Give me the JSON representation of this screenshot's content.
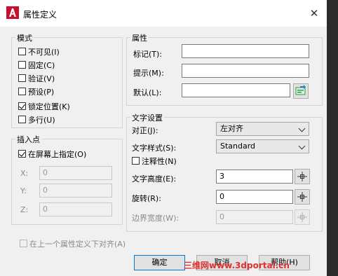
{
  "window": {
    "title": "属性定义",
    "close_glyph": "✕"
  },
  "mode": {
    "label": "模式",
    "options": [
      {
        "label": "不可见(I)",
        "checked": false
      },
      {
        "label": "固定(C)",
        "checked": false
      },
      {
        "label": "验证(V)",
        "checked": false
      },
      {
        "label": "预设(P)",
        "checked": false
      },
      {
        "label": "锁定位置(K)",
        "checked": true
      },
      {
        "label": "多行(U)",
        "checked": false
      }
    ]
  },
  "insertion": {
    "label": "插入点",
    "specify_on_screen": {
      "label": "在屏幕上指定(O)",
      "checked": true
    },
    "x": {
      "label": "X:",
      "value": "0"
    },
    "y": {
      "label": "Y:",
      "value": "0"
    },
    "z": {
      "label": "Z:",
      "value": "0"
    }
  },
  "attribute": {
    "label": "属性",
    "tag": {
      "label": "标记(T):",
      "value": ""
    },
    "prompt": {
      "label": "提示(M):",
      "value": ""
    },
    "default": {
      "label": "默认(L):",
      "value": ""
    }
  },
  "text_settings": {
    "label": "文字设置",
    "justification": {
      "label": "对正(J):",
      "value": "左对齐"
    },
    "text_style": {
      "label": "文字样式(S):",
      "value": "Standard"
    },
    "annotative": {
      "label": "注释性(N)",
      "checked": false
    },
    "text_height": {
      "label": "文字高度(E):",
      "value": "3"
    },
    "rotation": {
      "label": "旋转(R):",
      "value": "0"
    },
    "boundary_width": {
      "label": "边界宽度(W):",
      "value": "0"
    }
  },
  "align_below": {
    "label": "在上一个属性定义下对齐(A)",
    "checked": false
  },
  "buttons": {
    "ok": "确定",
    "cancel": "取消",
    "help": "帮助(H)"
  },
  "watermark": "三维网www.3dportal.cn",
  "colors": {
    "accent": "#0078d7",
    "app_icon": "#c8102e",
    "field_button_icon": "#2e9a3f",
    "watermark": "#e03030"
  }
}
